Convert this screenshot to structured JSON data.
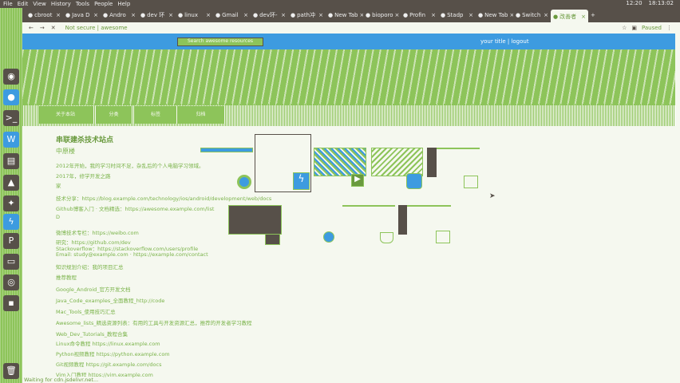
{
  "menubar": {
    "items": [
      "File",
      "Edit",
      "View",
      "History",
      "Tools",
      "People",
      "Help"
    ],
    "status": [
      "12:20",
      "18:13:02"
    ]
  },
  "launcher": {
    "icons": [
      "ubuntu-icon",
      "chrome-icon",
      "terminal-icon",
      "wps-icon",
      "files-icon",
      "image-icon",
      "android-studio-icon",
      "pycharm-icon",
      "presentation-icon",
      "disk-icon",
      "app-icon",
      "trash-icon"
    ]
  },
  "tabs": [
    {
      "label": "cbroot"
    },
    {
      "label": "Java D"
    },
    {
      "label": "Andro"
    },
    {
      "label": "dev 环"
    },
    {
      "label": "linux"
    },
    {
      "label": "Gmail"
    },
    {
      "label": "dev环-"
    },
    {
      "label": "path冲"
    },
    {
      "label": "New Tab"
    },
    {
      "label": "bioporo"
    },
    {
      "label": "Profin"
    },
    {
      "label": "Stadp"
    },
    {
      "label": "New Tab"
    },
    {
      "label": "Switch"
    },
    {
      "label": "改善者"
    }
  ],
  "address": {
    "security": "Not secure",
    "url": "awesome",
    "profile": "Paused"
  },
  "header": {
    "button": "Search awesome resources",
    "user": "your title | logout"
  },
  "nav": [
    "关于本站",
    "分类",
    "标签",
    "归档"
  ],
  "content": {
    "title": "串联建杀技术站点",
    "subtitle": "中原楼",
    "lines": [
      "2012年开始，我的学习时间不足，杂乱后的个人电脑学习领域。",
      "2017年，修学开发之路",
      "家",
      "技术分享：https://blog.example.com/technology/ios/android/development/web/docs",
      "Github博客入门  ·  文档精选：https://awesome.example.com/list",
      "D",
      "微博技术专栏：https://weibo.com",
      "研究：https://github.com/dev",
      "Stackoverflow：https://stackoverflow.com/users/profile",
      "Email: study@example.com · https://example.com/contact",
      "知识规划介绍：我的项目汇总",
      "推荐教程",
      "Google_Android_官方开发文档",
      "Java_Code_examples_全面教程_http://code",
      "Mac_Tools_使用技巧汇总",
      "Awesome_lists_精选资源列表：有用的工具与开发资源汇总，推荐的开发者学习教程",
      "Web_Dev_Tutorials_教程合集",
      "Linux命令教程  https://linux.example.com",
      "Python视频教程  https://python.example.com",
      "Git视频教程  https://git.example.com/docs",
      "Vim入门教程  https://vim.example.com"
    ]
  },
  "status": "Waiting for cdn.jsdelivr.net..."
}
